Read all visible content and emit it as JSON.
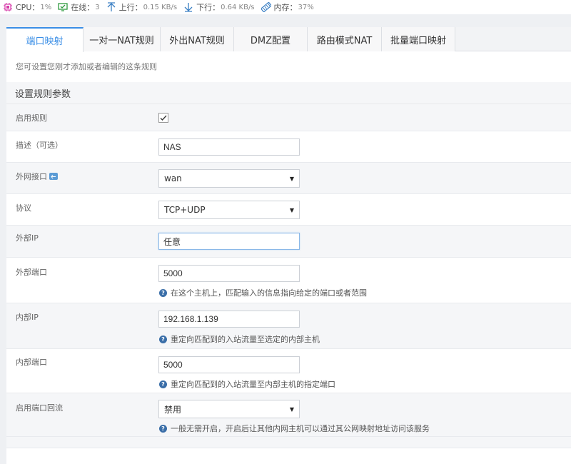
{
  "status": {
    "cpu_label": "CPU：",
    "cpu_value": "1%",
    "online_label": "在线：",
    "online_value": "3",
    "up_label": "上行：",
    "up_value": "0.15 KB/s",
    "down_label": "下行：",
    "down_value": "0.64 KB/s",
    "mem_label": "内存：",
    "mem_value": "37%"
  },
  "tabs": [
    {
      "label": "端口映射",
      "active": true
    },
    {
      "label": "一对一NAT规则",
      "active": false
    },
    {
      "label": "外出NAT规则",
      "active": false
    },
    {
      "label": "DMZ配置",
      "active": false
    },
    {
      "label": "路由模式NAT",
      "active": false
    },
    {
      "label": "批量端口映射",
      "active": false
    }
  ],
  "description": "您可设置您刚才添加或者编辑的这条规则",
  "section_title": "设置规则参数",
  "form": {
    "enable_rule": {
      "label": "启用规则",
      "checked": true
    },
    "desc_field": {
      "label": "描述（可选）",
      "value": "NAS"
    },
    "wan_iface": {
      "label": "外网接口",
      "value": "wan"
    },
    "protocol": {
      "label": "协议",
      "value": "TCP+UDP"
    },
    "ext_ip": {
      "label": "外部IP",
      "value": "任意"
    },
    "ext_port": {
      "label": "外部端口",
      "value": "5000",
      "help": "在这个主机上，匹配输入的信息指向给定的端口或者范围"
    },
    "int_ip": {
      "label": "内部IP",
      "value": "192.168.1.139",
      "help": "重定向匹配到的入站流量至选定的内部主机"
    },
    "int_port": {
      "label": "内部端口",
      "value": "5000",
      "help": "重定向匹配到的入站流量至内部主机的指定端口"
    },
    "loopback": {
      "label": "启用端口回流",
      "value": "禁用",
      "help": "一般无需开启，开启后让其他内网主机可以通过其公网映射地址访问该服务"
    }
  },
  "colors": {
    "accent": "#3a8ee6",
    "help_icon": "#3a6ea8"
  },
  "icons": {
    "cpu": "cpu-chip-icon",
    "online": "monitor-check-icon",
    "up": "arrow-up-icon",
    "down": "arrow-down-icon",
    "mem": "memory-stick-icon",
    "help": "question-circle-icon",
    "back": "return-arrow-icon"
  }
}
